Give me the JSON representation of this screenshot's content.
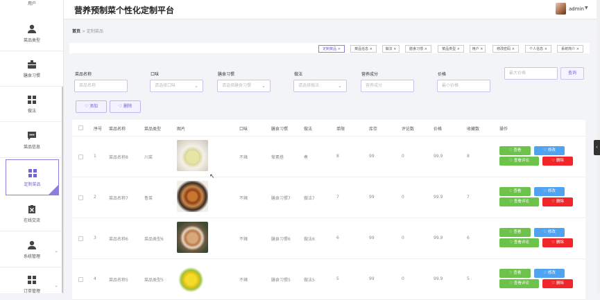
{
  "header": {
    "title": "营养预制菜个性化定制平台",
    "username": "admin",
    "caret": "▼"
  },
  "sidebar": {
    "top_label": "用户",
    "items": [
      {
        "label": "菜品类型",
        "icon": "person-icon"
      },
      {
        "label": "膳食习惯",
        "icon": "tray-icon"
      },
      {
        "label": "做法",
        "icon": "grid-icon"
      },
      {
        "label": "菜品信息",
        "icon": "chat-icon"
      },
      {
        "label": "定制菜品",
        "icon": "grid-icon"
      },
      {
        "label": "在线交流",
        "icon": "clipboard-icon"
      },
      {
        "label": "系统管理",
        "icon": "person-icon"
      },
      {
        "label": "订单管理",
        "icon": "grid-icon"
      }
    ]
  },
  "breadcrumb": {
    "home": "首页",
    "sep": ">",
    "current": "定制菜品"
  },
  "tags": [
    "定制菜品 ×",
    "菜品信息 ×",
    "做法 ×",
    "膳食习惯 ×",
    "菜品类型 ×",
    "用户 ×",
    "修改密码 ×",
    "个人信息 ×",
    "系统简介 ×"
  ],
  "filters": {
    "labels": [
      "菜品名称",
      "口味",
      "膳食习惯",
      "做法",
      "营养成分",
      "价格"
    ],
    "placeholders": [
      "菜品名称",
      "请选择口味",
      "请选择膳食习惯",
      "请选择做法",
      "营养成分",
      "最小价格",
      "最大价格"
    ],
    "search": "查询"
  },
  "ops": {
    "add": "♡ 添加",
    "delete": "♡ 删除"
  },
  "table": {
    "headers": [
      "序号",
      "菜品名称",
      "菜品类型",
      "图片",
      "口味",
      "膳食习惯",
      "做法",
      "单限",
      "库存",
      "评论数",
      "价格",
      "收藏数",
      "操作"
    ],
    "rows": [
      [
        "1",
        "菜品名称8",
        "川菜",
        "不辣",
        "荤素搭",
        "煮",
        "8",
        "99",
        "0",
        "99.9",
        "8"
      ],
      [
        "2",
        "菜品名称7",
        "鲁菜",
        "不辣",
        "膳食习惯7",
        "做法7",
        "7",
        "99",
        "0",
        "99.9",
        "7"
      ],
      [
        "3",
        "菜品名称6",
        "菜品类型6",
        "不辣",
        "膳食习惯6",
        "做法6",
        "6",
        "99",
        "0",
        "99.9",
        "6"
      ],
      [
        "4",
        "菜品名称5",
        "菜品类型5",
        "不辣",
        "膳食习惯5",
        "做法5",
        "5",
        "99",
        "0",
        "99.9",
        "5"
      ]
    ],
    "actions": {
      "view": "♡ 查看",
      "edit": "♡ 修改",
      "comments": "♡ 查看评论",
      "delete": "♡ 删除"
    }
  },
  "colors": {
    "accent": "#7063d6",
    "green": "#6cc24a",
    "blue": "#4fa3f0",
    "red": "#f0262a"
  }
}
